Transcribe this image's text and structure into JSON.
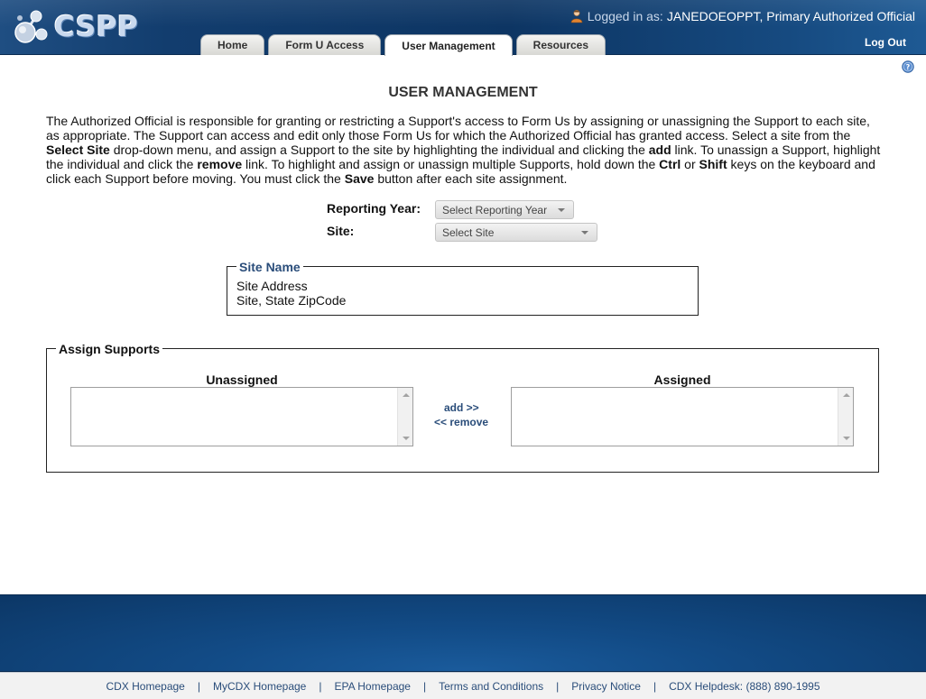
{
  "header": {
    "logo_text": "CSPP",
    "logged_in_prefix": "Logged in as:",
    "user_name": "JANEDOEOPPT, Primary Authorized Official",
    "logout_label": "Log Out",
    "tabs": [
      {
        "label": "Home",
        "active": false
      },
      {
        "label": "Form U Access",
        "active": false
      },
      {
        "label": "User Management",
        "active": true
      },
      {
        "label": "Resources",
        "active": false
      }
    ],
    "icons": {
      "user": "user-icon",
      "help": "help-icon"
    }
  },
  "main": {
    "title": "USER MANAGEMENT",
    "intro": {
      "p1": "The Authorized Official is responsible for granting or restricting a Support's access to Form Us by assigning or unassigning the Support to each site, as appropriate. The Support can access and edit only those Form Us for which the Authorized Official has granted access. Select a site from the ",
      "b1": "Select Site",
      "p2": " drop-down menu, and assign a Support to the site by highlighting the individual and clicking the ",
      "b2": "add",
      "p3": " link. To unassign a Support, highlight the individual and click the ",
      "b3": "remove",
      "p4": " link. To highlight and assign or unassign multiple Supports, hold down the ",
      "b4": "Ctrl",
      "p5": " or ",
      "b5": "Shift",
      "p6": " keys on the keyboard and click each Support before moving. You must click the ",
      "b6": "Save",
      "p7": " button after each site assignment."
    },
    "reporting_year": {
      "label": "Reporting Year:",
      "selected": "Select Reporting Year"
    },
    "site_select": {
      "label": "Site:",
      "selected": "Select Site"
    },
    "site_info": {
      "legend": "Site Name",
      "address": "Site Address",
      "city_state_zip": "Site, State ZipCode"
    },
    "assign": {
      "legend": "Assign Supports",
      "unassigned_title": "Unassigned",
      "assigned_title": "Assigned",
      "add_label": "add >>",
      "remove_label": "<< remove",
      "unassigned_items": [],
      "assigned_items": []
    }
  },
  "footer": {
    "links": [
      "CDX Homepage",
      "MyCDX Homepage",
      "EPA Homepage",
      "Terms and Conditions",
      "Privacy Notice",
      "CDX Helpdesk: (888) 890-1995"
    ],
    "separator": "|"
  },
  "colors": {
    "header": "#0d3563",
    "link": "#2a4d7a",
    "footer": "#124b86"
  }
}
